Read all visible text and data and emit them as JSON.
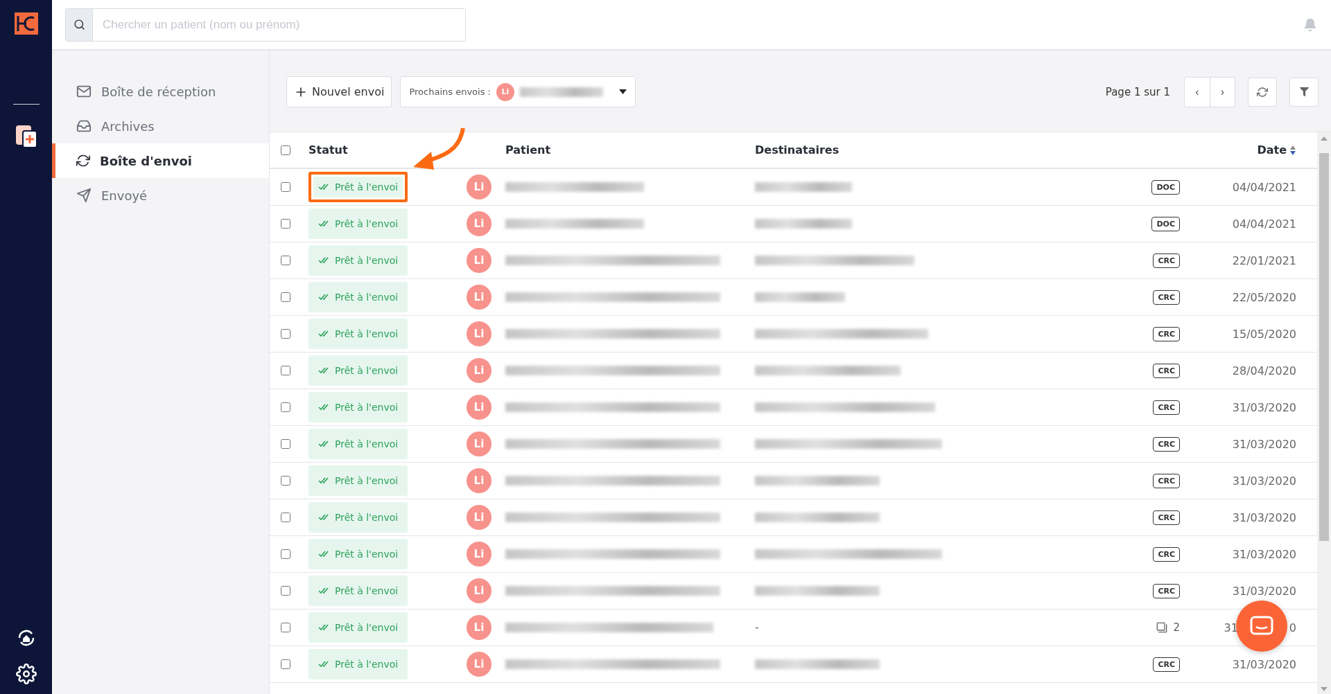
{
  "search": {
    "placeholder": "Chercher un patient (nom ou prénom)"
  },
  "sidebar": {
    "items": [
      {
        "label": "Boîte de réception",
        "selected": false
      },
      {
        "label": "Archives",
        "selected": false
      },
      {
        "label": "Boîte d'envoi",
        "selected": true
      },
      {
        "label": "Envoyé",
        "selected": false
      }
    ]
  },
  "toolbar": {
    "new_button": "Nouvel envoi",
    "next_sends_label": "Prochains envois :",
    "next_sends_avatar": "Li",
    "pagination": "Page 1 sur 1",
    "prev": "‹",
    "next": "›"
  },
  "table": {
    "select_all_checked": false,
    "columns": [
      {
        "label": "Statut",
        "sorted": false
      },
      {
        "label": "Patient",
        "sorted": false
      },
      {
        "label": "Destinataires",
        "sorted": false
      },
      {
        "label": "Date",
        "sorted": true
      }
    ],
    "rows": [
      {
        "checked": false,
        "status": "Prêt à l'envoi",
        "avatar": "Li",
        "highlighted": true,
        "recipients_text": "",
        "kind": "tag",
        "tag": "DOC",
        "date": "04/04/2021"
      },
      {
        "checked": false,
        "status": "Prêt à l'envoi",
        "avatar": "Li",
        "highlighted": false,
        "recipients_text": "",
        "kind": "tag",
        "tag": "DOC",
        "date": "04/04/2021"
      },
      {
        "checked": false,
        "status": "Prêt à l'envoi",
        "avatar": "Li",
        "highlighted": false,
        "recipients_text": "",
        "kind": "tag",
        "tag": "CRC",
        "date": "22/01/2021"
      },
      {
        "checked": false,
        "status": "Prêt à l'envoi",
        "avatar": "Li",
        "highlighted": false,
        "recipients_text": "",
        "kind": "tag",
        "tag": "CRC",
        "date": "22/05/2020"
      },
      {
        "checked": false,
        "status": "Prêt à l'envoi",
        "avatar": "Li",
        "highlighted": false,
        "recipients_text": "",
        "kind": "tag",
        "tag": "CRC",
        "date": "15/05/2020"
      },
      {
        "checked": false,
        "status": "Prêt à l'envoi",
        "avatar": "Li",
        "highlighted": false,
        "recipients_text": "",
        "kind": "tag",
        "tag": "CRC",
        "date": "28/04/2020"
      },
      {
        "checked": false,
        "status": "Prêt à l'envoi",
        "avatar": "Li",
        "highlighted": false,
        "recipients_text": "",
        "kind": "tag",
        "tag": "CRC",
        "date": "31/03/2020"
      },
      {
        "checked": false,
        "status": "Prêt à l'envoi",
        "avatar": "Li",
        "highlighted": false,
        "recipients_text": "",
        "kind": "tag",
        "tag": "CRC",
        "date": "31/03/2020"
      },
      {
        "checked": false,
        "status": "Prêt à l'envoi",
        "avatar": "Li",
        "highlighted": false,
        "recipients_text": "",
        "kind": "tag",
        "tag": "CRC",
        "date": "31/03/2020"
      },
      {
        "checked": false,
        "status": "Prêt à l'envoi",
        "avatar": "Li",
        "highlighted": false,
        "recipients_text": "",
        "kind": "tag",
        "tag": "CRC",
        "date": "31/03/2020"
      },
      {
        "checked": false,
        "status": "Prêt à l'envoi",
        "avatar": "Li",
        "highlighted": false,
        "recipients_text": "",
        "kind": "tag",
        "tag": "CRC",
        "date": "31/03/2020"
      },
      {
        "checked": false,
        "status": "Prêt à l'envoi",
        "avatar": "Li",
        "highlighted": false,
        "recipients_text": "",
        "kind": "tag",
        "tag": "CRC",
        "date": "31/03/2020"
      },
      {
        "checked": false,
        "status": "Prêt à l'envoi",
        "avatar": "Li",
        "highlighted": false,
        "recipients_text": "-",
        "kind": "count",
        "tag": "2",
        "date": "31",
        "date_tail": "0"
      },
      {
        "checked": false,
        "status": "Prêt à l'envoi",
        "avatar": "Li",
        "highlighted": false,
        "recipients_text": "",
        "kind": "tag",
        "tag": "CRC",
        "date": "31/03/2020"
      }
    ]
  }
}
